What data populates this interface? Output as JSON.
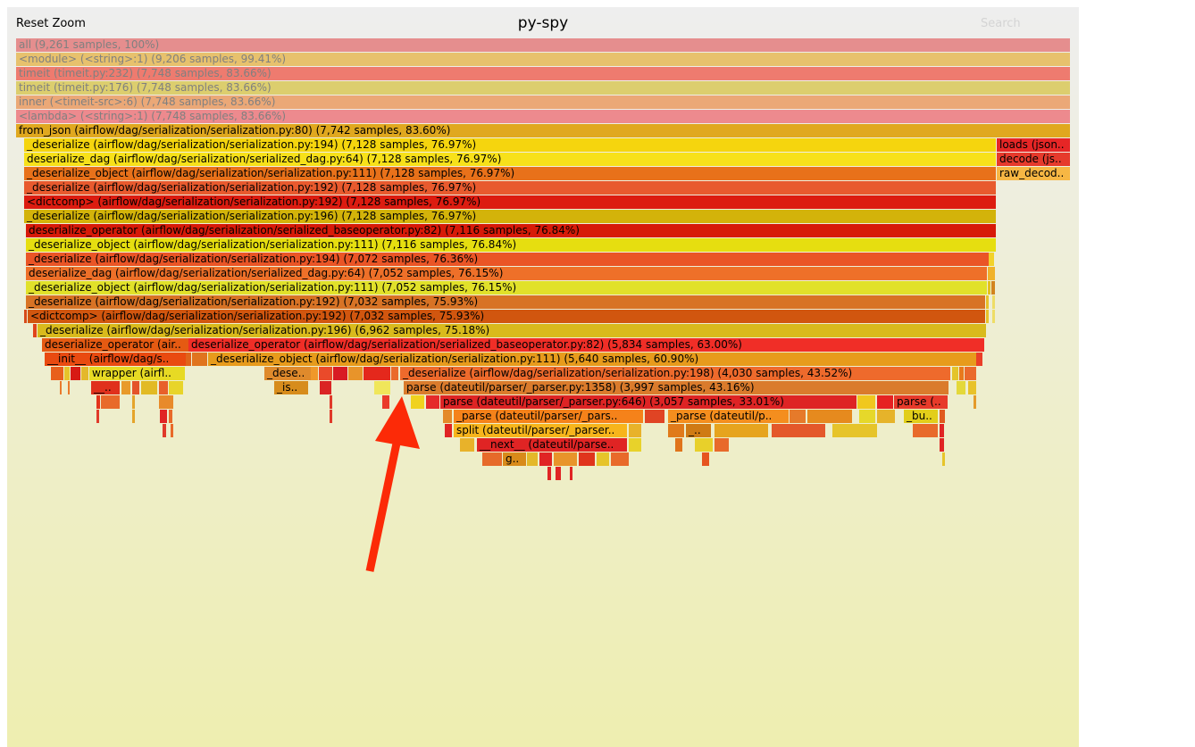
{
  "header": {
    "title": "py-spy",
    "reset_zoom_label": "Reset Zoom",
    "search_label": "Search"
  },
  "annotation": {
    "type": "arrow",
    "color": "#fc2a07",
    "points_to": "parse (dateutil/parser/_parser.py:1358)"
  },
  "frames": [
    {
      "label": "all (9,261 samples, 100%)",
      "color": "#e58e8e",
      "dim": true
    },
    {
      "label": "<module> (<string>:1) (9,206 samples, 99.41%)",
      "color": "#e7c16d",
      "dim": true
    },
    {
      "label": "timeit (timeit.py:232) (7,748 samples, 83.66%)",
      "color": "#ee7b6f",
      "dim": true
    },
    {
      "label": "timeit (timeit.py:176) (7,748 samples, 83.66%)",
      "color": "#dcce6e",
      "dim": true
    },
    {
      "label": "inner (<timeit-src>:6) (7,748 samples, 83.66%)",
      "color": "#eba877",
      "dim": true
    },
    {
      "label": "<lambda> (<string>:1) (7,748 samples, 83.66%)",
      "color": "#ed8a8e",
      "dim": true
    },
    {
      "label": "from_json (airflow/dag/serialization/serialization.py:80) (7,742 samples, 83.60%)",
      "color": "#e0a81f"
    },
    {
      "label": "_deserialize (airflow/dag/serialization/serialization.py:194) (7,128 samples, 76.97%)",
      "color": "#f5d50e"
    },
    {
      "label": "deserialize_dag (airflow/dag/serialization/serialized_dag.py:64) (7,128 samples, 76.97%)",
      "color": "#f7e11a"
    },
    {
      "label": "_deserialize_object (airflow/dag/serialization/serialization.py:111) (7,128 samples, 76.97%)",
      "color": "#e8711a"
    },
    {
      "label": "_deserialize (airflow/dag/serialization/serialization.py:192) (7,128 samples, 76.97%)",
      "color": "#e85a2e"
    },
    {
      "label": "<dictcomp> (airflow/dag/serialization/serialization.py:192) (7,128 samples, 76.97%)",
      "color": "#dc1c10"
    },
    {
      "label": "_deserialize (airflow/dag/serialization/serialization.py:196) (7,128 samples, 76.97%)",
      "color": "#d3b30a"
    },
    {
      "label": "deserialize_operator (airflow/dag/serialization/serialized_baseoperator.py:82) (7,116 samples, 76.84%)",
      "color": "#d71a08"
    },
    {
      "label": "_deserialize_object (airflow/dag/serialization/serialization.py:111) (7,116 samples, 76.84%)",
      "color": "#e6de10"
    },
    {
      "label": "_deserialize (airflow/dag/serialization/serialization.py:194) (7,072 samples, 76.36%)",
      "color": "#ea5526"
    },
    {
      "label": "deserialize_dag (airflow/dag/serialization/serialized_dag.py:64) (7,052 samples, 76.15%)",
      "color": "#ee7029"
    },
    {
      "label": "_deserialize_object (airflow/dag/serialization/serialization.py:111) (7,052 samples, 76.15%)",
      "color": "#e1e12a"
    },
    {
      "label": "_deserialize (airflow/dag/serialization/serialization.py:192) (7,032 samples, 75.93%)",
      "color": "#d87325"
    },
    {
      "label": "<dictcomp> (airflow/dag/serialization/serialization.py:192) (7,032 samples, 75.93%)",
      "color": "#d1560f"
    },
    {
      "label": "_deserialize (airflow/dag/serialization/serialization.py:196) (6,962 samples, 75.18%)",
      "color": "#d9ba1c"
    },
    {
      "label": "deserialize_operator (air..",
      "color": "#e55a12"
    },
    {
      "label": "deserialize_operator (airflow/dag/serialization/serialized_baseoperator.py:82) (5,834 samples, 63.00%)",
      "color": "#f02e27"
    },
    {
      "label": "__init__ (airflow/dag/s..",
      "color": "#e94a10"
    },
    {
      "label": "_deserialize_object (airflow/dag/serialization/serialization.py:111) (5,640 samples, 60.90%)",
      "color": "#e79b1c"
    },
    {
      "label": "wrapper (airfl..",
      "color": "#e7da24"
    },
    {
      "label": "_dese..",
      "color": "#df8a2c"
    },
    {
      "label": "_deserialize (airflow/dag/serialization/serialization.py:198) (4,030 samples, 43.52%)",
      "color": "#ee6a2c"
    },
    {
      "label": "__..",
      "color": "#e0301c"
    },
    {
      "label": "_is..",
      "color": "#d78c1c"
    },
    {
      "label": "parse (dateutil/parser/_parser.py:1358) (3,997 samples, 43.16%)",
      "color": "#da7b2c"
    },
    {
      "label": "parse (dateutil/parser/_parser.py:646) (3,057 samples, 33.01%)",
      "color": "#de2424"
    },
    {
      "label": "parse (..",
      "color": "#e73a2a"
    },
    {
      "label": "_parse (dateutil/parser/_pars..",
      "color": "#f5821a"
    },
    {
      "label": "_parse (dateutil/p..",
      "color": "#f48e1e"
    },
    {
      "label": "_bu..",
      "color": "#e2ce1a"
    },
    {
      "label": "split (dateutil/parser/_parser..",
      "color": "#f7b51c"
    },
    {
      "label": "_..",
      "color": "#cf7a14"
    },
    {
      "label": "__next__ (dateutil/parse..",
      "color": "#e02424"
    },
    {
      "label": "raw_decod..",
      "color": "#f7b744"
    },
    {
      "label": "loads (json..",
      "color": "#e62626"
    },
    {
      "label": "decode (js..",
      "color": "#e63a2c"
    },
    {
      "label": "g..",
      "color": "#d88a1a"
    }
  ]
}
